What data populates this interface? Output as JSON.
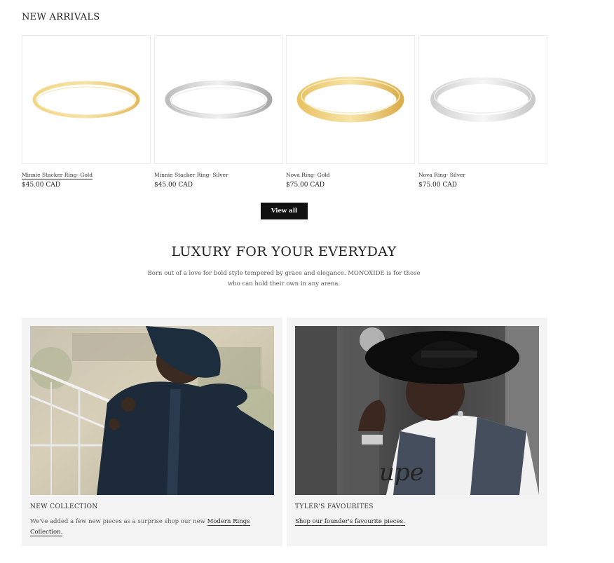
{
  "new_arrivals": {
    "title": "NEW ARRIVALS",
    "products": [
      {
        "name": "Minnie Stacker Ring- Gold",
        "price": "$45.00 CAD",
        "metal": "gold",
        "icon": "gold-ring-icon"
      },
      {
        "name": "Minnie Stacker Ring- Silver",
        "price": "$45.00 CAD",
        "metal": "silver",
        "icon": "silver-ring-icon"
      },
      {
        "name": "Nova Ring- Gold",
        "price": "$75.00 CAD",
        "metal": "gold",
        "icon": "gold-ring-icon"
      },
      {
        "name": "Nova Ring- Silver",
        "price": "$75.00 CAD",
        "metal": "silver",
        "icon": "silver-ring-icon"
      }
    ],
    "view_all_label": "View all"
  },
  "hero": {
    "title": "LUXURY FOR YOUR EVERYDAY",
    "text": "Born out of a love for bold style tempered by grace and elegance. MONOXIDE is for those who can hold their own in any arena."
  },
  "collections": [
    {
      "label": "NEW COLLECTION",
      "text": "We've added a few new pieces as a surprise shop our new ",
      "link": "Modern Rings Collection."
    },
    {
      "label": "TYLER'S FAVOURITES",
      "text": "",
      "link": "Shop our founder's favourite pieces."
    }
  ],
  "colors": {
    "gold": "#e9c466",
    "silver": "#d8d8d8",
    "button": "#111111",
    "card_bg": "#f4f4f4"
  }
}
